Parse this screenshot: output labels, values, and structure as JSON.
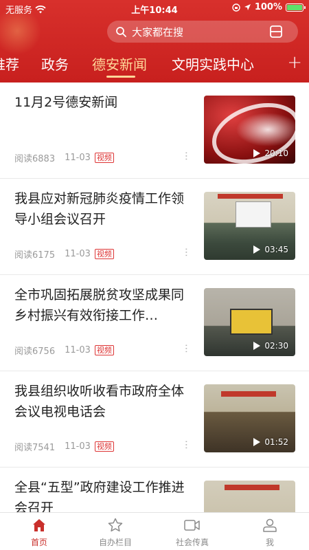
{
  "status_bar": {
    "carrier": "无服务",
    "time": "上午10:44",
    "battery": "100%"
  },
  "search": {
    "placeholder": "大家都在搜"
  },
  "tabs": [
    {
      "label": "推荐"
    },
    {
      "label": "政务"
    },
    {
      "label": "德安新闻"
    },
    {
      "label": "文明实践中心"
    }
  ],
  "active_tab": "德安新闻",
  "add_tab": "+",
  "news": [
    {
      "title": "11月2号德安新闻",
      "reads": "阅读6883",
      "date": "11-03",
      "badge": "视频",
      "duration": "20:10"
    },
    {
      "title": "我县应对新冠肺炎疫情工作领导小组会议召开",
      "reads": "阅读6175",
      "date": "11-03",
      "badge": "视频",
      "duration": "03:45"
    },
    {
      "title": "全市巩固拓展脱贫攻坚成果同乡村振兴有效衔接工作…",
      "reads": "阅读6756",
      "date": "11-03",
      "badge": "视频",
      "duration": "02:30"
    },
    {
      "title": "我县组织收听收看市政府全体会议电视电话会",
      "reads": "阅读7541",
      "date": "11-03",
      "badge": "视频",
      "duration": "01:52"
    },
    {
      "title": "全县“五型”政府建设工作推进会召开",
      "reads": "",
      "date": "",
      "badge": "",
      "duration": ""
    }
  ],
  "bottom_nav": [
    {
      "label": "首页",
      "icon": "home-icon",
      "active": true
    },
    {
      "label": "自办栏目",
      "icon": "star-icon",
      "active": false
    },
    {
      "label": "社会传真",
      "icon": "video-camera-icon",
      "active": false
    },
    {
      "label": "我",
      "icon": "user-icon",
      "active": false
    }
  ],
  "colors": {
    "brand_red": "#c9302c",
    "active_tab": "#ffd89a",
    "badge": "#dd3333"
  }
}
